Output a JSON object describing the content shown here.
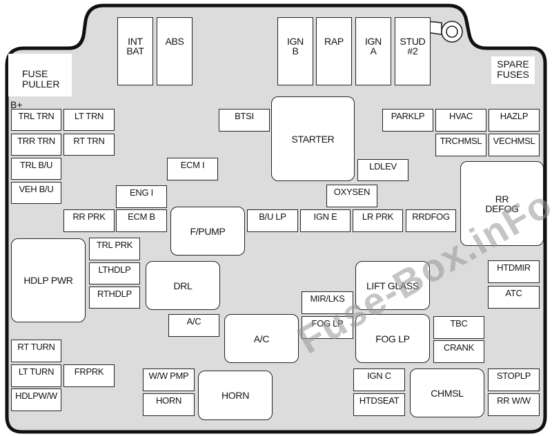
{
  "colors": {
    "housing_fill": "#dcdcdc",
    "outline": "#111111",
    "fuse_fill": "#ffffff"
  },
  "labels": {
    "fuse_puller": "FUSE\nPULLER",
    "b_plus": "B+",
    "spare_fuses": "SPARE\nFUSES"
  },
  "watermark": "Fuse-Box.inFo",
  "fuses": [
    {
      "label": "INT\nBAT",
      "kind": "maxi"
    },
    {
      "label": "ABS",
      "kind": "maxi"
    },
    {
      "label": "IGN\nB",
      "kind": "maxi"
    },
    {
      "label": "RAP",
      "kind": "maxi"
    },
    {
      "label": "IGN\nA",
      "kind": "maxi"
    },
    {
      "label": "STUD\n#2",
      "kind": "maxi"
    },
    {
      "label": "TRL TRN",
      "kind": "mini"
    },
    {
      "label": "LT TRN",
      "kind": "mini"
    },
    {
      "label": "TRR TRN",
      "kind": "mini"
    },
    {
      "label": "RT TRN",
      "kind": "mini"
    },
    {
      "label": "TRL B/U",
      "kind": "mini"
    },
    {
      "label": "VEH B/U",
      "kind": "mini"
    },
    {
      "label": "BTSI",
      "kind": "mini"
    },
    {
      "label": "ECM I",
      "kind": "mini"
    },
    {
      "label": "ENG I",
      "kind": "mini"
    },
    {
      "label": "RR PRK",
      "kind": "mini"
    },
    {
      "label": "ECM B",
      "kind": "mini"
    },
    {
      "label": "B/U LP",
      "kind": "mini"
    },
    {
      "label": "IGN E",
      "kind": "mini"
    },
    {
      "label": "LR PRK",
      "kind": "mini"
    },
    {
      "label": "RRDFOG",
      "kind": "mini"
    },
    {
      "label": "OXYSEN",
      "kind": "mini"
    },
    {
      "label": "LDLEV",
      "kind": "mini"
    },
    {
      "label": "PARKLP",
      "kind": "mini"
    },
    {
      "label": "HVAC",
      "kind": "mini"
    },
    {
      "label": "HAZLP",
      "kind": "mini"
    },
    {
      "label": "TRCHMSL",
      "kind": "mini"
    },
    {
      "label": "VECHMSL",
      "kind": "mini"
    },
    {
      "label": "STARTER",
      "kind": "relay"
    },
    {
      "label": "RR\nDEFOG",
      "kind": "relay"
    },
    {
      "label": "F/PUMP",
      "kind": "relay"
    },
    {
      "label": "HDLP PWR",
      "kind": "relay"
    },
    {
      "label": "TRL PRK",
      "kind": "mini"
    },
    {
      "label": "LTHDLP",
      "kind": "mini"
    },
    {
      "label": "RTHDLP",
      "kind": "mini"
    },
    {
      "label": "DRL",
      "kind": "relay"
    },
    {
      "label": "A/C",
      "kind": "mini"
    },
    {
      "label": "A/C",
      "kind": "relay"
    },
    {
      "label": "RT TURN",
      "kind": "mini"
    },
    {
      "label": "LT TURN",
      "kind": "mini"
    },
    {
      "label": "FRPRK",
      "kind": "mini"
    },
    {
      "label": "HDLPW/W",
      "kind": "mini"
    },
    {
      "label": "W/W PMP",
      "kind": "mini"
    },
    {
      "label": "HORN",
      "kind": "mini"
    },
    {
      "label": "HORN",
      "kind": "relay"
    },
    {
      "label": "MIR/LKS",
      "kind": "mini"
    },
    {
      "label": "FOG LP",
      "kind": "mini"
    },
    {
      "label": "LIFT GLASS",
      "kind": "relay"
    },
    {
      "label": "FOG LP",
      "kind": "relay"
    },
    {
      "label": "HTDMIR",
      "kind": "mini"
    },
    {
      "label": "ATC",
      "kind": "mini"
    },
    {
      "label": "TBC",
      "kind": "mini"
    },
    {
      "label": "CRANK",
      "kind": "mini"
    },
    {
      "label": "IGN C",
      "kind": "mini"
    },
    {
      "label": "HTDSEAT",
      "kind": "mini"
    },
    {
      "label": "CHMSL",
      "kind": "relay"
    },
    {
      "label": "STOPLP",
      "kind": "mini"
    },
    {
      "label": "RR W/W",
      "kind": "mini"
    }
  ]
}
